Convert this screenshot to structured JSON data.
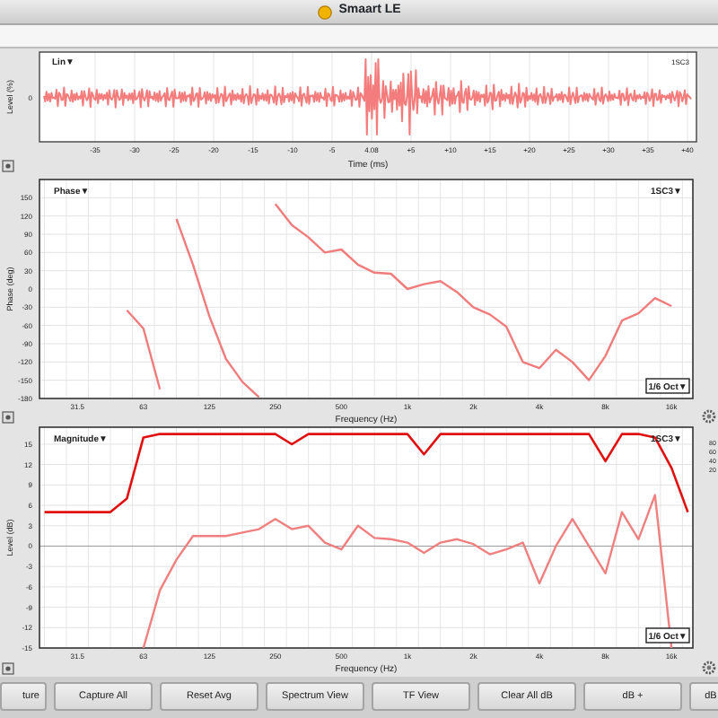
{
  "window": {
    "title": "Smaart LE"
  },
  "time_panel": {
    "mode": "Lin▼",
    "source": "1SC3",
    "ylabel": "Level (%)",
    "ytick": "0",
    "xlabel": "Time (ms)",
    "xticks": [
      "-35",
      "-30",
      "-25",
      "-20",
      "-15",
      "-10",
      "-5",
      "4.08",
      "+5",
      "+10",
      "+15",
      "+20",
      "+25",
      "+30",
      "+35",
      "+40"
    ]
  },
  "phase_panel": {
    "mode": "Phase▼",
    "source": "1SC3▼",
    "smoothing": "1/6 Oct▼",
    "chart_data": {
      "type": "line",
      "xlabel": "Frequency (Hz)",
      "ylabel": "Phase (deg)",
      "categories": [
        null,
        null,
        "31.5",
        null,
        null,
        null,
        "63",
        null,
        null,
        null,
        "125",
        null,
        null,
        null,
        "250",
        null,
        null,
        null,
        "500",
        null,
        null,
        null,
        "1k",
        null,
        null,
        null,
        "2k",
        null,
        null,
        null,
        "4k",
        null,
        null,
        null,
        "8k",
        null,
        null,
        null,
        "16k",
        null
      ],
      "series": [
        {
          "color": "#f07c7c",
          "values": [
            null,
            null,
            null,
            null,
            null,
            -35,
            -65,
            -165,
            115,
            40,
            -45,
            -115,
            -153,
            -178,
            140,
            105,
            85,
            60,
            65,
            40,
            27,
            25,
            0,
            8,
            13,
            -5,
            -30,
            -42,
            -62,
            -120,
            -130,
            -100,
            -120,
            -150,
            -110,
            -52,
            -40,
            -15,
            -28,
            null
          ]
        }
      ],
      "ylim": [
        -180,
        180
      ],
      "grid": true,
      "yticks": [
        150,
        120,
        90,
        60,
        30,
        0,
        -30,
        -60,
        -90,
        -120,
        -150,
        -180
      ]
    }
  },
  "magnitude_panel": {
    "mode": "Magnitude▼",
    "source": "1SC3▼",
    "smoothing": "1/6 Oct▼",
    "right_axis_labels": [
      "80",
      "60",
      "40",
      "20"
    ],
    "chart_data": {
      "type": "line",
      "xlabel": "Frequency (Hz)",
      "ylabel": "Level (dB)",
      "categories": [
        null,
        null,
        "31.5",
        null,
        null,
        null,
        "63",
        null,
        null,
        null,
        "125",
        null,
        null,
        null,
        "250",
        null,
        null,
        null,
        "500",
        null,
        null,
        null,
        "1k",
        null,
        null,
        null,
        "2k",
        null,
        null,
        null,
        "4k",
        null,
        null,
        null,
        "8k",
        null,
        null,
        null,
        "16k",
        null
      ],
      "series": [
        {
          "color": "#e01010",
          "values": [
            5,
            5,
            5,
            5,
            5,
            7,
            16,
            16.5,
            16.5,
            16.5,
            16.5,
            16.5,
            16.5,
            16.5,
            16.5,
            15,
            16.5,
            16.5,
            16.5,
            16.5,
            16.5,
            16.5,
            16.5,
            13.5,
            16.5,
            16.5,
            16.5,
            16.5,
            16.5,
            16.5,
            16.5,
            16.5,
            16.5,
            16.5,
            12.5,
            16.5,
            16.5,
            16,
            11.5,
            5
          ]
        },
        {
          "color": "#f08080",
          "values": [
            null,
            null,
            null,
            null,
            null,
            null,
            -15,
            -6.5,
            -2,
            1.5,
            1.5,
            1.5,
            2,
            2.5,
            4,
            2.5,
            3,
            0.5,
            -0.5,
            3,
            1.2,
            1,
            0.5,
            -1,
            0.5,
            1,
            0.3,
            -1.2,
            -0.5,
            0.5,
            -5.5,
            0,
            4,
            0,
            -4,
            5,
            1,
            7.5,
            -15,
            null
          ]
        }
      ],
      "ylim": [
        -15,
        17.5
      ],
      "grid": true,
      "yticks": [
        15,
        12,
        9,
        6,
        3,
        0,
        -3,
        -6,
        -9,
        -12,
        -15
      ]
    }
  },
  "buttons": [
    "ture",
    "Capture All",
    "Reset Avg",
    "Spectrum View",
    "TF View",
    "Clear All dB",
    "dB +",
    "dB"
  ]
}
